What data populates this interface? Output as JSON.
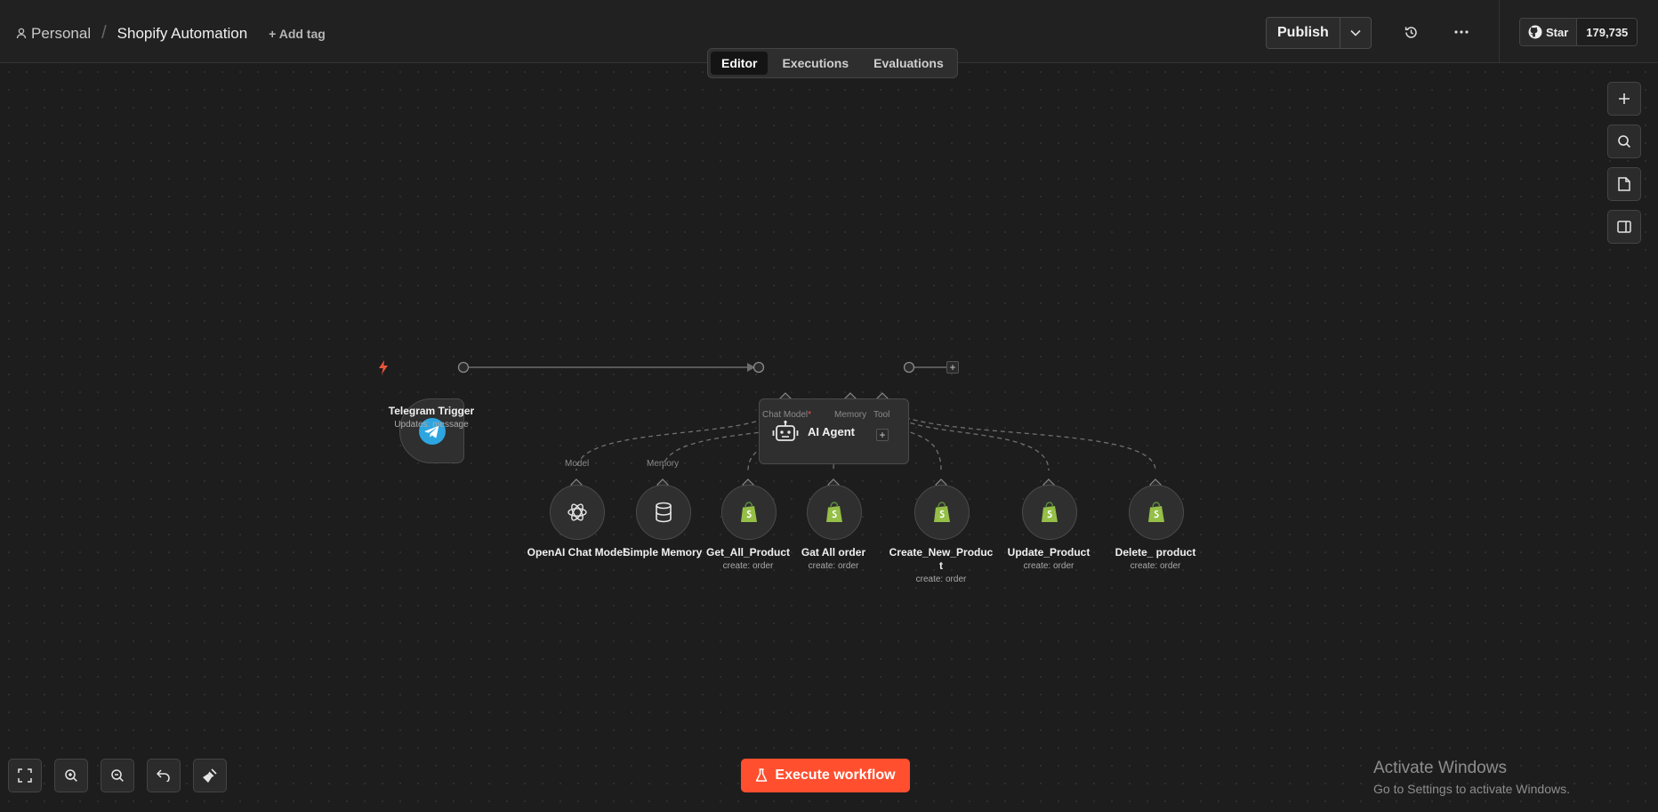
{
  "header": {
    "personal_label": "Personal",
    "workflow_title": "Shopify Automation",
    "add_tag_label": "+ Add tag",
    "publish_label": "Publish",
    "github_star_label": "Star",
    "github_star_count": "179,735"
  },
  "tabs": [
    {
      "label": "Editor",
      "active": true
    },
    {
      "label": "Executions",
      "active": false
    },
    {
      "label": "Evaluations",
      "active": false
    }
  ],
  "nodes": {
    "trigger": {
      "title": "Telegram Trigger",
      "subtitle": "Updates: message",
      "icon": "telegram-icon"
    },
    "agent": {
      "title": "AI Agent",
      "icon": "robot-icon",
      "ports": {
        "chat_model": "Chat Model",
        "chat_model_required": "*",
        "memory": "Memory",
        "tool": "Tool"
      }
    },
    "subnodes": [
      {
        "title": "OpenAI Chat Model",
        "subtitle": "",
        "port_label": "Model",
        "icon": "openai-icon"
      },
      {
        "title": "Simple Memory",
        "subtitle": "",
        "port_label": "Memory",
        "icon": "database-icon"
      },
      {
        "title": "Get_All_Product",
        "subtitle": "create: order",
        "port_label": "",
        "icon": "shopify-icon"
      },
      {
        "title": "Gat All order",
        "subtitle": "create: order",
        "port_label": "",
        "icon": "shopify-icon"
      },
      {
        "title": "Create_New_Product",
        "subtitle": "create: order",
        "port_label": "",
        "icon": "shopify-icon"
      },
      {
        "title": "Update_Product",
        "subtitle": "create: order",
        "port_label": "",
        "icon": "shopify-icon"
      },
      {
        "title": "Delete_ product",
        "subtitle": "create: order",
        "port_label": "",
        "icon": "shopify-icon"
      }
    ]
  },
  "execute_label": "Execute workflow",
  "watermark": {
    "line1": "Activate Windows",
    "line2": "Go to Settings to activate Windows."
  },
  "colors": {
    "accent": "#ff4f2f",
    "shopify": "#95bf47",
    "telegram": "#2ca5e0",
    "trigger_bolt": "#e8553a"
  }
}
